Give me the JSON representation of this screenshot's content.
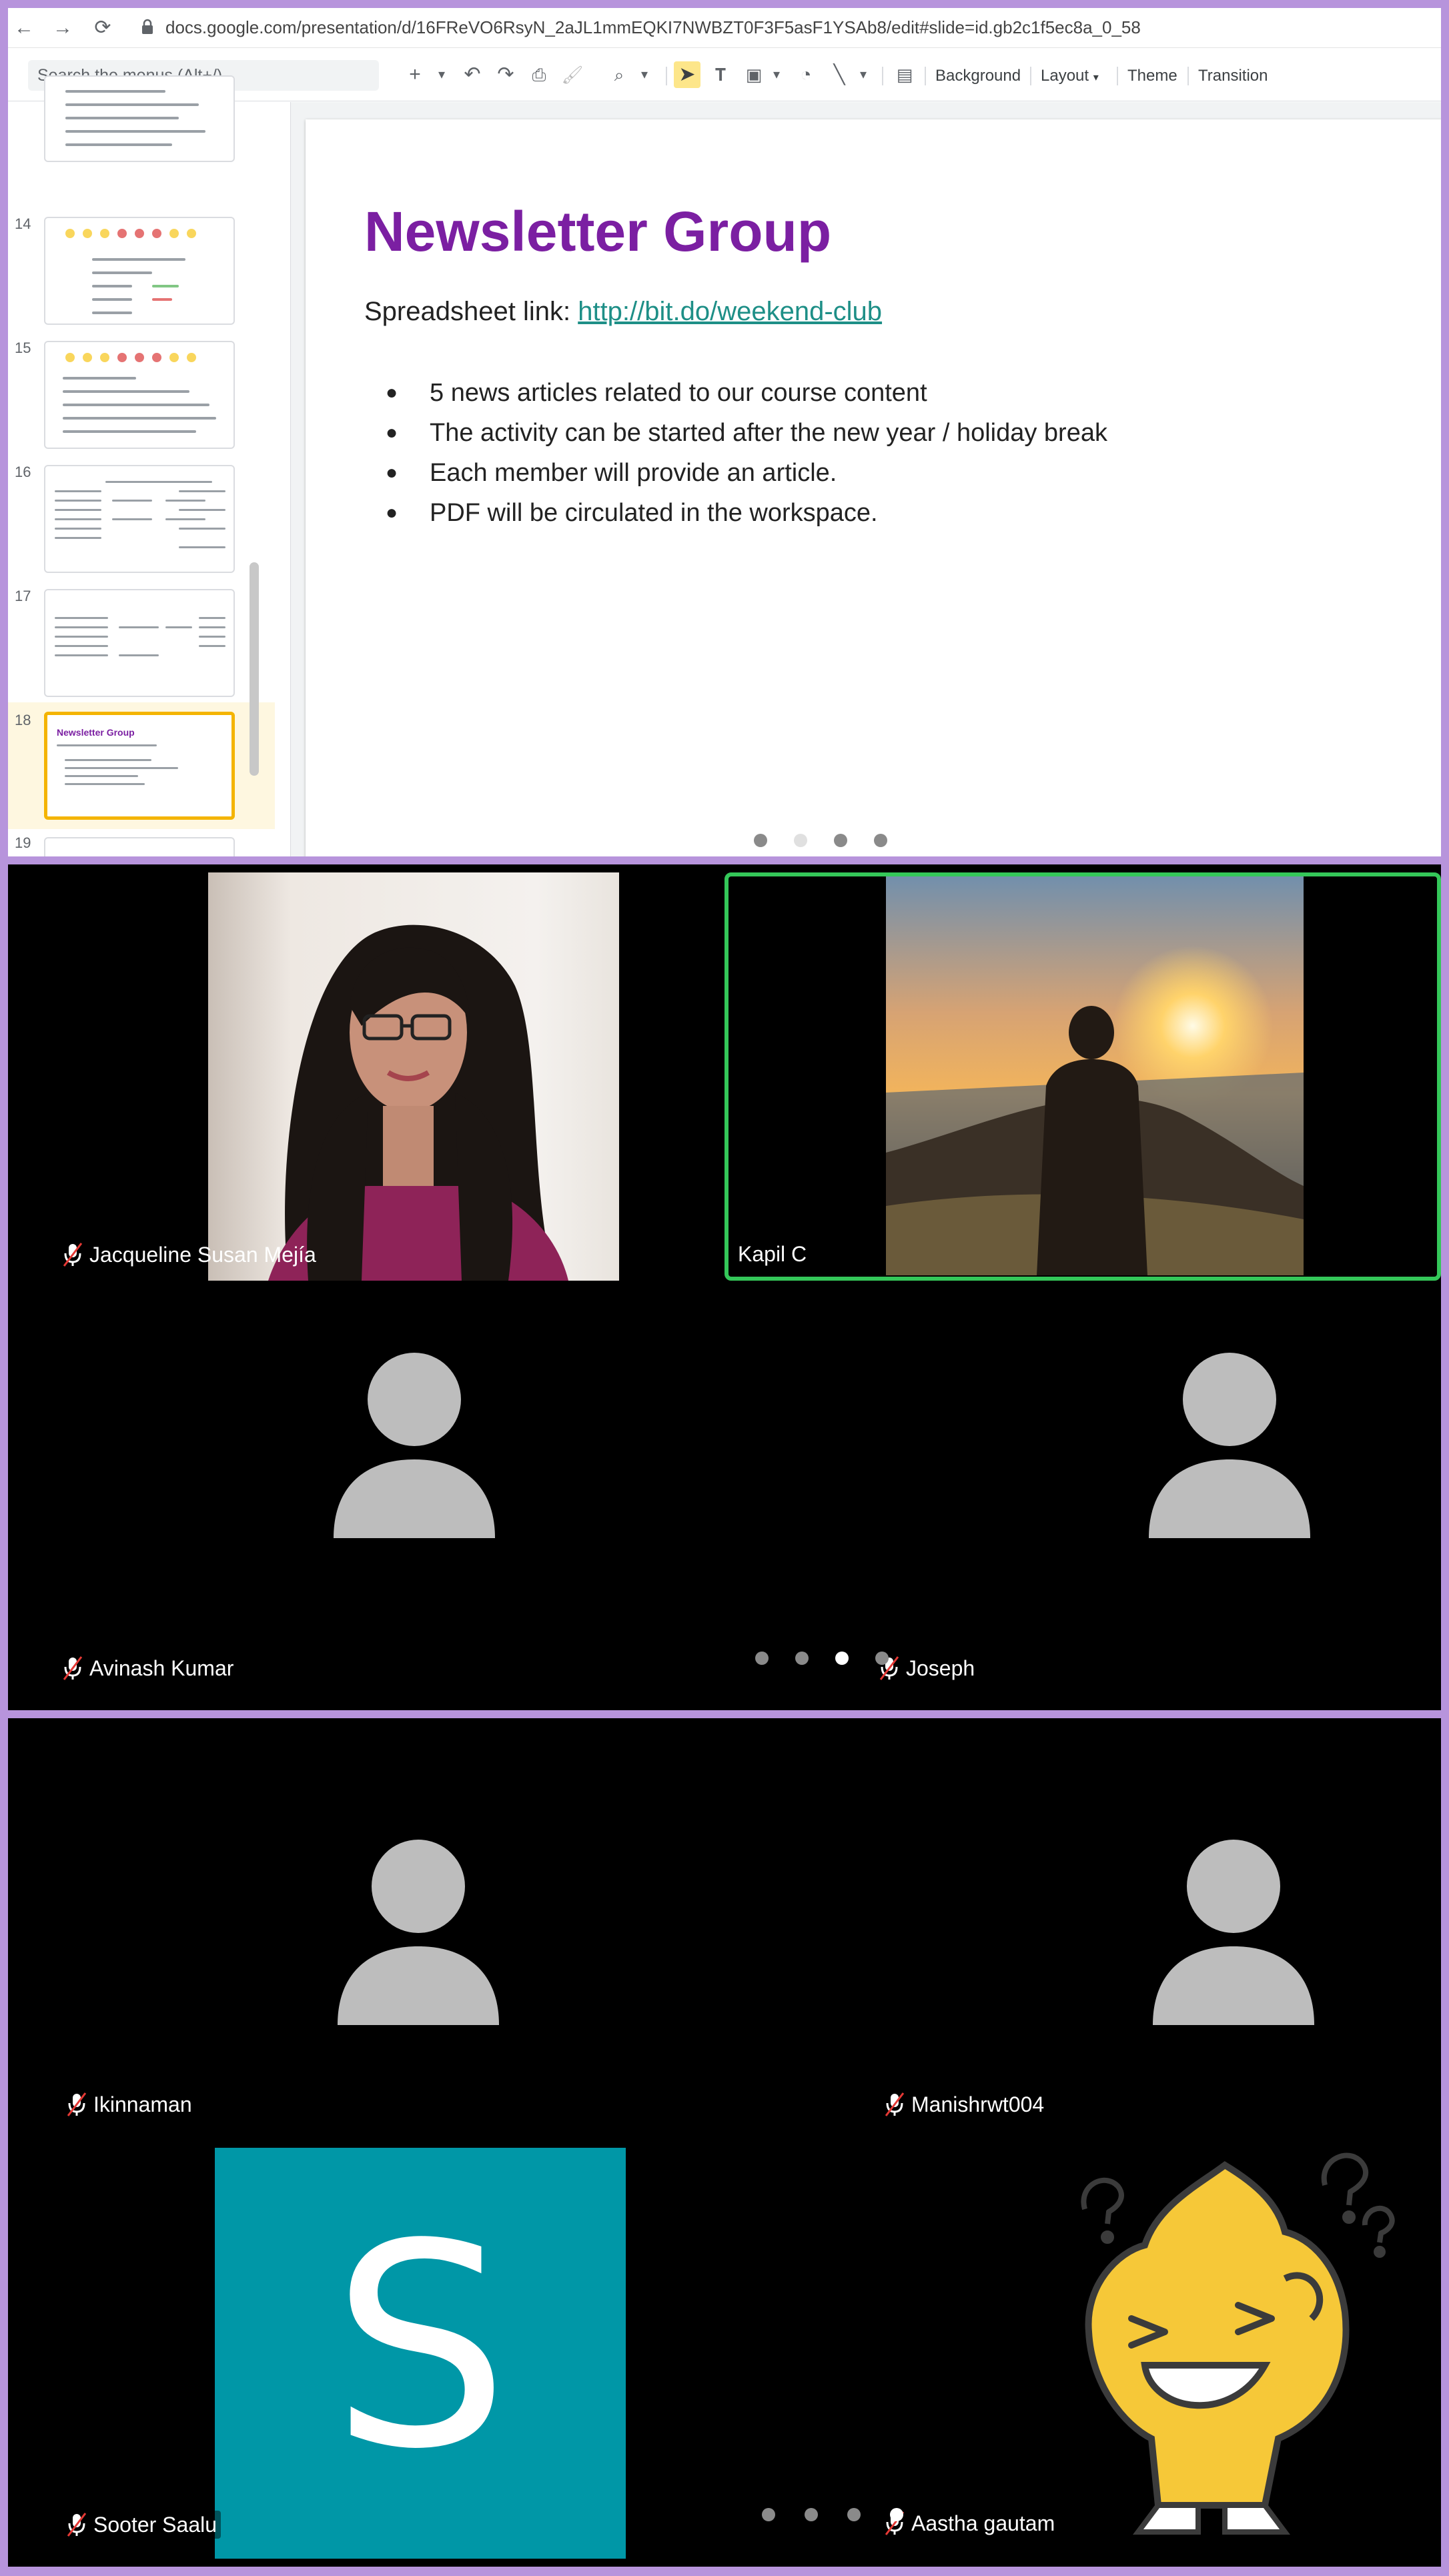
{
  "browser": {
    "back_icon": "arrow-left-icon",
    "forward_icon": "arrow-right-icon",
    "reload_icon": "reload-icon",
    "url": "docs.google.com/presentation/d/16FReVO6RsyN_2aJL1mmEQKI7NWBZT0F3F5asF1YSAb8/edit#slide=id.gb2c1f5ec8a_0_58"
  },
  "toolbar": {
    "search_placeholder": "Search the menus (Alt+/)",
    "background_label": "Background",
    "layout_label": "Layout",
    "theme_label": "Theme",
    "transition_label": "Transition"
  },
  "filmstrip": {
    "slides": [
      {
        "number": "14"
      },
      {
        "number": "15"
      },
      {
        "number": "16"
      },
      {
        "number": "17"
      },
      {
        "number": "18",
        "title": "Newsletter Group",
        "selected": true
      },
      {
        "number": "19"
      }
    ]
  },
  "slide": {
    "title": "Newsletter Group",
    "link_prefix": "Spreadsheet link: ",
    "link_text": "http://bit.do/weekend-club",
    "bullets": [
      "5 news articles related to our course content",
      "The activity can be started after the new year / holiday break",
      "Each member will provide an article.",
      "PDF will be circulated in the workspace."
    ]
  },
  "colors": {
    "title_purple": "#7b1fa2",
    "link_teal": "#1e8f87",
    "frame_lavender": "#b794dc",
    "speaking_green": "#34c759",
    "s_avatar_teal": "#0097a7",
    "selected_thumb_border": "#f4b400"
  },
  "meeting_page_2": {
    "participants": [
      {
        "name": "Jacqueline Susan Mejía",
        "muted": true,
        "video": "camera"
      },
      {
        "name": "Kapil C",
        "muted": false,
        "video": "camera",
        "speaking": true
      },
      {
        "name": "Avinash Kumar",
        "muted": true,
        "video": "avatar-placeholder"
      },
      {
        "name": "Joseph",
        "muted": true,
        "video": "avatar-placeholder"
      }
    ]
  },
  "meeting_page_3": {
    "participants": [
      {
        "name": "Ikinnaman",
        "muted": true,
        "video": "avatar-placeholder"
      },
      {
        "name": "Manishrwt004",
        "muted": true,
        "video": "avatar-placeholder"
      },
      {
        "name": "Sooter Saalu",
        "muted": true,
        "video": "letter-avatar",
        "initial": "S"
      },
      {
        "name": "Aastha gautam",
        "muted": true,
        "video": "sticker"
      }
    ]
  }
}
